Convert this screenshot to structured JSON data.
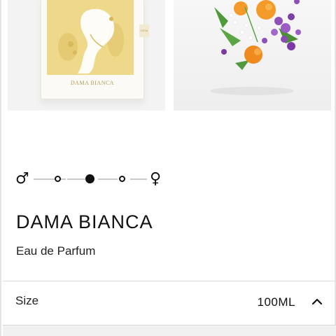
{
  "gallery": {
    "images": [
      {
        "name": "dama-bianca-box-image",
        "icon": "perfume-box-image",
        "brand_text": "DAMA BIANCA",
        "tag_text": "CASA"
      },
      {
        "name": "dama-bianca-ingredients-image",
        "icon": "flowers-citrus-image"
      }
    ]
  },
  "gender_scale": {
    "left_icon": "male-symbol-icon",
    "right_icon": "female-symbol-icon",
    "left_glyph": "♂",
    "right_glyph": "♀",
    "positions": 3,
    "selected_index": 1
  },
  "product": {
    "name": "DAMA BIANCA",
    "type": "Eau de Parfum"
  },
  "size": {
    "label": "Size",
    "value": "100ML",
    "expanded": true,
    "chevron_icon": "chevron-up-icon"
  },
  "colors": {
    "accent_gold": "#e9d17c",
    "text": "#111111",
    "divider": "#dddddd"
  }
}
